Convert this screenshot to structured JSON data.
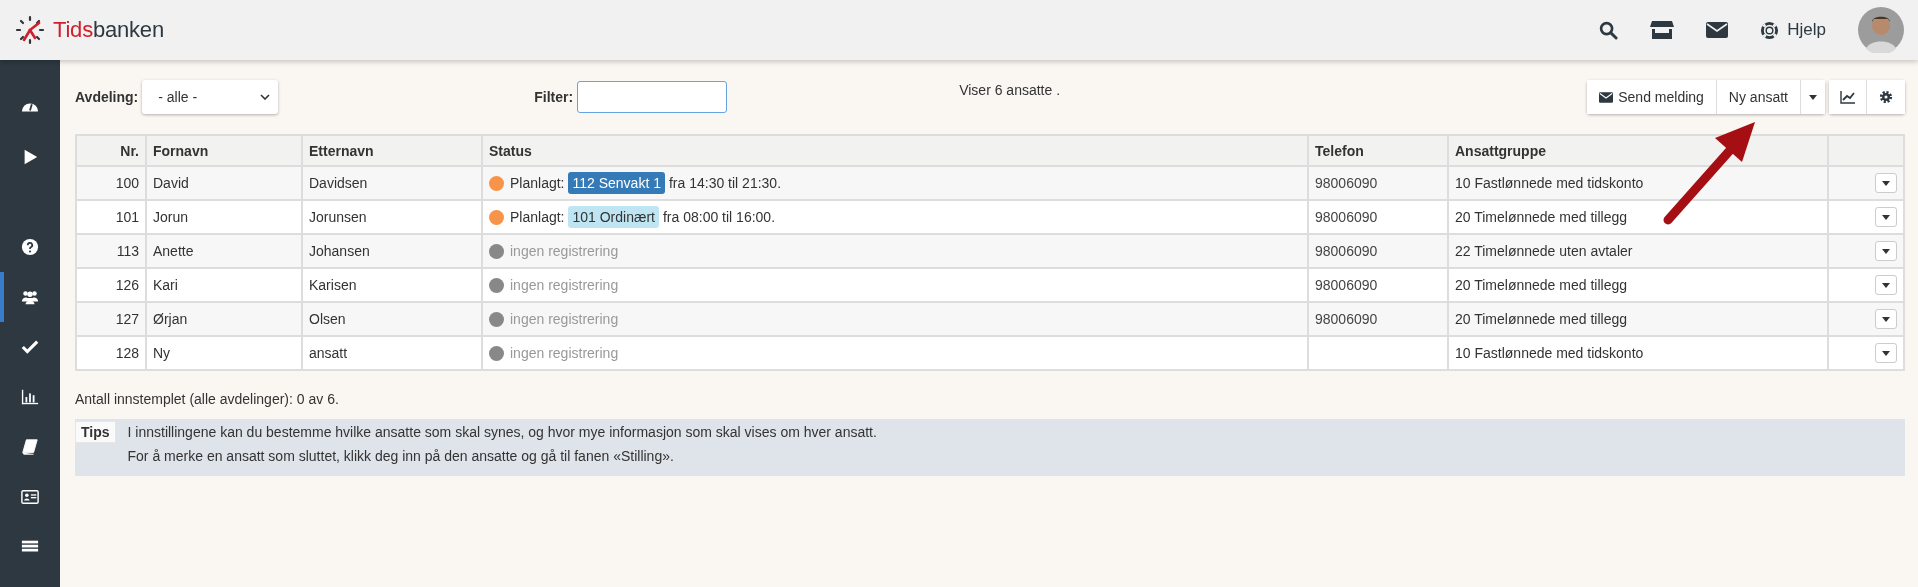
{
  "header": {
    "brand_prefix": "Tids",
    "brand_suffix": "banken",
    "help": "Hjelp"
  },
  "sidebar": {
    "groups": [
      [
        {
          "selected": false
        },
        {
          "selected": false
        }
      ],
      [
        {
          "selected": false
        },
        {
          "selected": true
        },
        {
          "selected": false
        },
        {
          "selected": false
        },
        {
          "selected": false
        },
        {
          "selected": false
        },
        {
          "selected": false
        }
      ]
    ]
  },
  "toolbar": {
    "department_label": "Avdeling:",
    "department_value": "- alle -",
    "filter_label": "Filter:",
    "count_text": "Viser 6 ansatte .",
    "send_button": "Send melding",
    "new_button": "Ny ansatt"
  },
  "table": {
    "columns": [
      "Nr.",
      "Fornavn",
      "Etternavn",
      "Status",
      "Telefon",
      "Ansattgruppe"
    ],
    "rows": [
      {
        "nr": "100",
        "first": "David",
        "last": "Davidsen",
        "status": {
          "kind": "planned",
          "color": "#f7944a",
          "label": "Planlagt:",
          "shift": {
            "text": "112 Senvakt 1",
            "color": "#337ab7"
          },
          "time": "fra 14:30 til 21:30."
        },
        "phone": "98006090",
        "group": "10 Fastlønnede med tidskonto"
      },
      {
        "nr": "101",
        "first": "Jorun",
        "last": "Jorunsen",
        "status": {
          "kind": "planned",
          "color": "#f7944a",
          "label": "Planlagt:",
          "shift": {
            "text": "101 Ordinært",
            "color": "#bfe5f2"
          },
          "time": "fra 08:00 til 16:00."
        },
        "phone": "98006090",
        "group": "20 Timelønnede med tillegg"
      },
      {
        "nr": "113",
        "first": "Anette",
        "last": "Johansen",
        "status": {
          "kind": "none",
          "color": "#888888",
          "label": "ingen registrering"
        },
        "phone": "98006090",
        "group": "22 Timelønnede uten avtaler"
      },
      {
        "nr": "126",
        "first": "Kari",
        "last": "Karisen",
        "status": {
          "kind": "none",
          "color": "#888888",
          "label": "ingen registrering"
        },
        "phone": "98006090",
        "group": "20 Timelønnede med tillegg"
      },
      {
        "nr": "127",
        "first": "Ørjan",
        "last": "Olsen",
        "status": {
          "kind": "none",
          "color": "#888888",
          "label": "ingen registrering"
        },
        "phone": "98006090",
        "group": "20 Timelønnede med tillegg"
      },
      {
        "nr": "128",
        "first": "Ny",
        "last": "ansatt",
        "status": {
          "kind": "none",
          "color": "#888888",
          "label": "ingen registrering"
        },
        "group": "10 Fastlønnede med tidskonto"
      }
    ]
  },
  "summary": "Antall innstemplet (alle avdelinger): 0 av 6.",
  "tips": {
    "label": "Tips",
    "lines": [
      "I innstillingene kan du bestemme hvilke ansatte som skal synes, og hvor mye informasjon som skal vises om hver ansatt.",
      "For å merke en ansatt som sluttet, klikk deg inn på den ansatte og gå til fanen «Stilling»."
    ]
  }
}
